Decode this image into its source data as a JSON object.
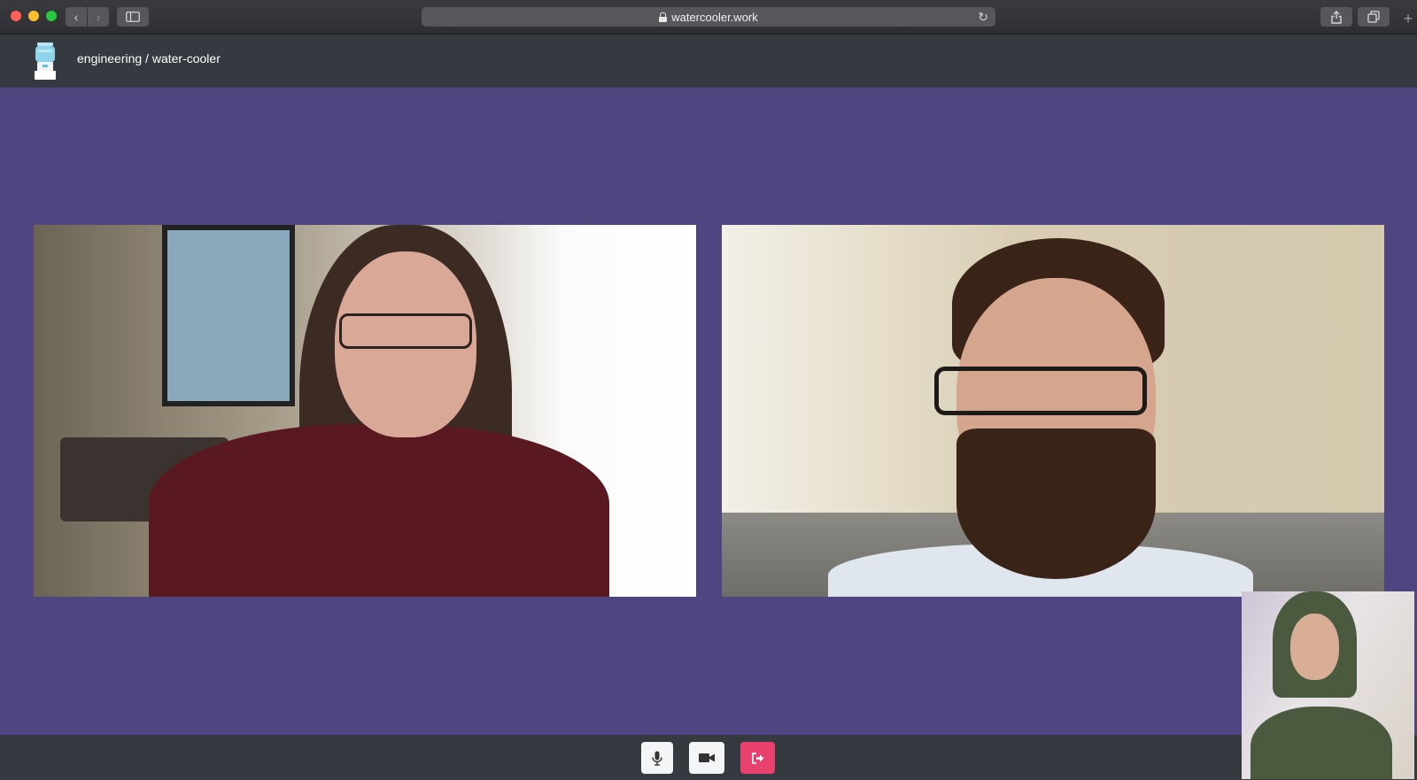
{
  "browser": {
    "url": "watercooler.work",
    "back_label": "‹",
    "forward_label": "›",
    "new_tab_label": "+",
    "reload_glyph": "↻"
  },
  "app": {
    "room_path": "engineering / water-cooler",
    "logo_icon": "water-cooler-icon"
  },
  "call": {
    "participants": [
      {
        "tile": "remote-video-1"
      },
      {
        "tile": "remote-video-2"
      }
    ],
    "self_view": "local-video"
  },
  "controls": {
    "mic_icon": "microphone-icon",
    "camera_icon": "video-camera-icon",
    "leave_icon": "leave-call-icon",
    "leave_color": "#e8416d"
  },
  "colors": {
    "stage_bg": "#4f4581",
    "header_bg": "#343a40",
    "control_bar_bg": "#343a40"
  }
}
